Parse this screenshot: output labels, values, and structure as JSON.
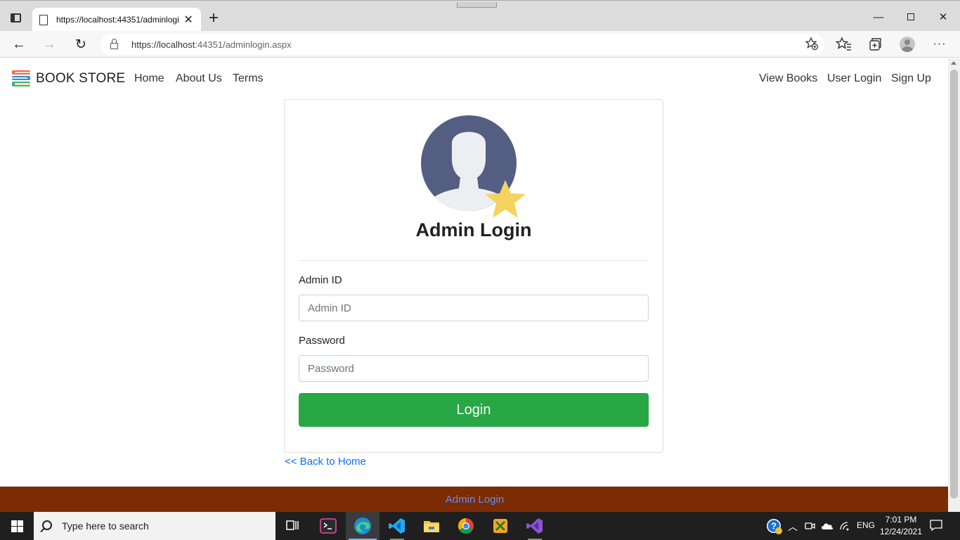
{
  "browser": {
    "tab_title": "https://localhost:44351/adminlogin.aspx",
    "tab_close": "✕",
    "new_tab": "+",
    "url_host": "https://localhost",
    "url_rest": ":44351/adminlogin.aspx",
    "window_controls": {
      "minimize": "—",
      "maximize": "",
      "close": "✕"
    },
    "nav": {
      "back": "←",
      "forward": "→",
      "refresh": "↻",
      "more": "···"
    }
  },
  "site": {
    "brand": "BOOK STORE",
    "nav_left": [
      "Home",
      "About Us",
      "Terms"
    ],
    "nav_right": [
      "View Books",
      "User Login",
      "Sign Up"
    ]
  },
  "login": {
    "title": "Admin Login",
    "admin_id_label": "Admin ID",
    "admin_id_placeholder": "Admin ID",
    "admin_id_value": "",
    "password_label": "Password",
    "password_placeholder": "Password",
    "password_value": "",
    "button": "Login",
    "back_link": "<< Back to Home"
  },
  "footer": {
    "link": "Admin Login"
  },
  "taskbar": {
    "search_placeholder": "Type here to search",
    "language": "ENG",
    "time": "7:01 PM",
    "date": "12/24/2021"
  },
  "colors": {
    "primary_button": "#28a745",
    "footer_bg": "#7b2c02",
    "link": "#0d6efd",
    "avatar_bg": "#545e82",
    "star": "#f4d35e"
  }
}
